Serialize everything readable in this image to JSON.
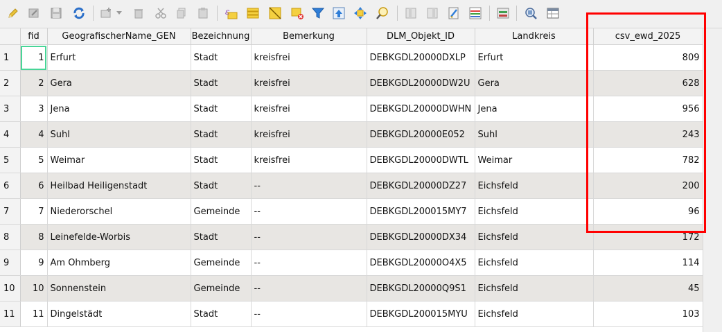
{
  "toolbar": {
    "icons": [
      "toggle-editing-icon",
      "multi-edit-icon",
      "save-edits-icon",
      "reload-table-icon",
      "add-feature-icon",
      "delete-feature-icon",
      "cut-icon",
      "copy-icon",
      "paste-icon",
      "expression-select-icon",
      "select-all-icon",
      "invert-selection-icon",
      "deselect-all-icon",
      "filter-selected-icon",
      "move-selection-to-top-icon",
      "pan-to-selected-icon",
      "zoom-to-selected-icon",
      "new-field-icon",
      "delete-field-icon",
      "field-calculator-icon",
      "conditional-formatting-icon",
      "actions-icon",
      "dock-table-icon",
      "table-view-icon"
    ]
  },
  "table": {
    "columns": [
      "fid",
      "GeografischerName_GEN",
      "Bezeichnung",
      "Bemerkung",
      "DLM_Objekt_ID",
      "Landkreis",
      "csv_ewd_2025"
    ],
    "rows": [
      {
        "row": "1",
        "fid": "1",
        "name": "Erfurt",
        "bez": "Stadt",
        "bem": "kreisfrei",
        "dlm": "DEBKGDL20000DXLP",
        "kreis": "Erfurt",
        "ewd": "809"
      },
      {
        "row": "2",
        "fid": "2",
        "name": "Gera",
        "bez": "Stadt",
        "bem": "kreisfrei",
        "dlm": "DEBKGDL20000DW2U",
        "kreis": "Gera",
        "ewd": "628"
      },
      {
        "row": "3",
        "fid": "3",
        "name": "Jena",
        "bez": "Stadt",
        "bem": "kreisfrei",
        "dlm": "DEBKGDL20000DWHN",
        "kreis": "Jena",
        "ewd": "956"
      },
      {
        "row": "4",
        "fid": "4",
        "name": "Suhl",
        "bez": "Stadt",
        "bem": "kreisfrei",
        "dlm": "DEBKGDL20000E052",
        "kreis": "Suhl",
        "ewd": "243"
      },
      {
        "row": "5",
        "fid": "5",
        "name": "Weimar",
        "bez": "Stadt",
        "bem": "kreisfrei",
        "dlm": "DEBKGDL20000DWTL",
        "kreis": "Weimar",
        "ewd": "782"
      },
      {
        "row": "6",
        "fid": "6",
        "name": "Heilbad Heiligenstadt",
        "bez": "Stadt",
        "bem": "--",
        "dlm": "DEBKGDL20000DZ27",
        "kreis": "Eichsfeld",
        "ewd": "200"
      },
      {
        "row": "7",
        "fid": "7",
        "name": "Niederorschel",
        "bez": "Gemeinde",
        "bem": "--",
        "dlm": "DEBKGDL200015MY7",
        "kreis": "Eichsfeld",
        "ewd": "96"
      },
      {
        "row": "8",
        "fid": "8",
        "name": "Leinefelde-Worbis",
        "bez": "Stadt",
        "bem": "--",
        "dlm": "DEBKGDL20000DX34",
        "kreis": "Eichsfeld",
        "ewd": "172"
      },
      {
        "row": "9",
        "fid": "9",
        "name": "Am Ohmberg",
        "bez": "Gemeinde",
        "bem": "--",
        "dlm": "DEBKGDL20000O4X5",
        "kreis": "Eichsfeld",
        "ewd": "114"
      },
      {
        "row": "10",
        "fid": "10",
        "name": "Sonnenstein",
        "bez": "Gemeinde",
        "bem": "--",
        "dlm": "DEBKGDL20000Q9S1",
        "kreis": "Eichsfeld",
        "ewd": "45"
      },
      {
        "row": "11",
        "fid": "11",
        "name": "Dingelstädt",
        "bez": "Stadt",
        "bem": "--",
        "dlm": "DEBKGDL200015MYU",
        "kreis": "Eichsfeld",
        "ewd": "103"
      }
    ]
  },
  "colors": {
    "highlight": "#ff0000",
    "focus": "#48d597",
    "alt_row": "#e8e6e3"
  }
}
